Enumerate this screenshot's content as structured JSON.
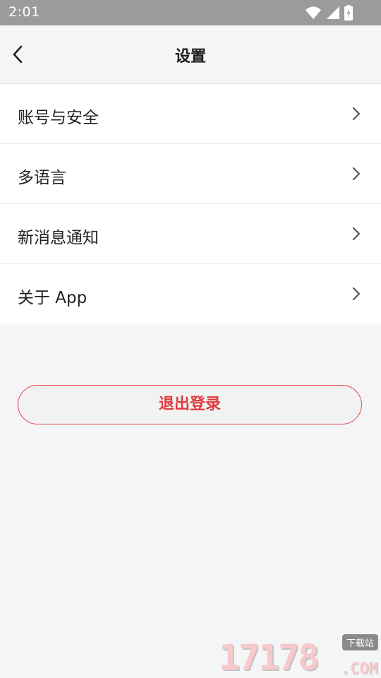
{
  "status_bar": {
    "time": "2:01",
    "icons": [
      "wifi-icon",
      "signal-icon",
      "battery-icon"
    ]
  },
  "header": {
    "title": "设置"
  },
  "menu": {
    "items": [
      {
        "label": "账号与安全"
      },
      {
        "label": "多语言"
      },
      {
        "label": "新消息通知"
      },
      {
        "label": "关于 App"
      }
    ]
  },
  "logout": {
    "label": "退出登录"
  },
  "watermark": {
    "number": "17178",
    "badge": "下载站",
    "domain": ".COM"
  },
  "colors": {
    "accent": "#e03c3c",
    "background": "#f4f5f7",
    "status_bar": "#9b9b9b"
  }
}
